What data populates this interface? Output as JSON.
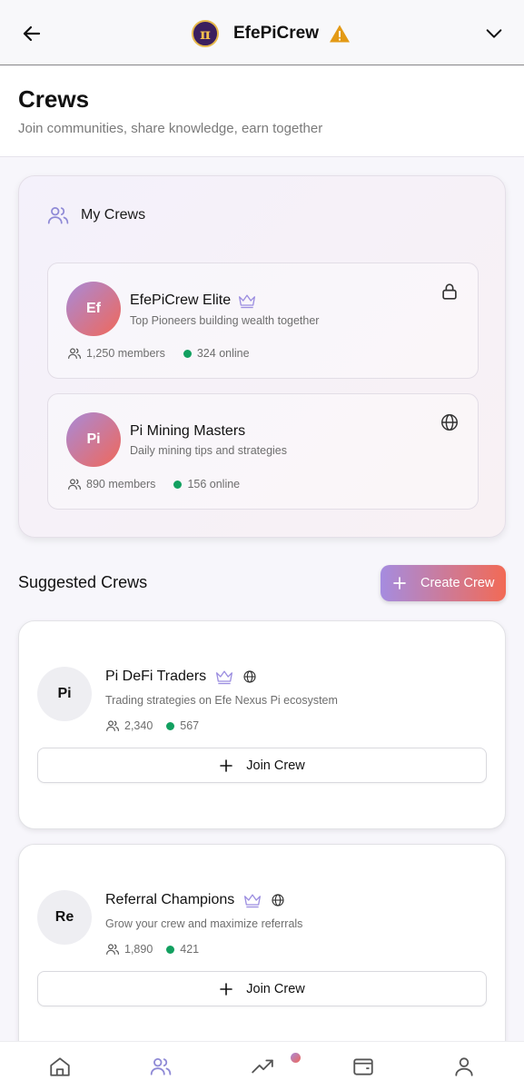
{
  "topbar": {
    "app_title": "EfePiCrew",
    "logo_glyph": "π",
    "back_icon": "arrow-left-icon",
    "warning_icon": "warning-icon",
    "chevron_icon": "chevron-down-icon"
  },
  "header": {
    "title": "Crews",
    "subtitle": "Join communities, share knowledge, earn together"
  },
  "my_crews": {
    "label": "My Crews",
    "items": [
      {
        "initials": "Ef",
        "name": "EfePiCrew Elite",
        "description": "Top Pioneers building wealth together",
        "members": "1,250 members",
        "online": "324 online",
        "badge_icon": "crown-icon",
        "corner_icon": "lock-icon"
      },
      {
        "initials": "Pi",
        "name": "Pi Mining Masters",
        "description": "Daily mining tips and strategies",
        "members": "890 members",
        "online": "156 online",
        "corner_icon": "globe-icon"
      }
    ]
  },
  "suggested": {
    "title": "Suggested Crews",
    "create_label": "Create Crew",
    "join_label": "Join Crew",
    "items": [
      {
        "initials": "Pi",
        "name": "Pi DeFi Traders",
        "description": "Trading strategies on Efe Nexus Pi ecosystem",
        "members": "2,340",
        "online": "567"
      },
      {
        "initials": "Re",
        "name": "Referral Champions",
        "description": "Grow your crew and maximize referrals",
        "members": "1,890",
        "online": "421"
      }
    ]
  },
  "bottom_nav": {
    "items": [
      "home-icon",
      "crews-icon",
      "trending-icon",
      "wallet-icon",
      "profile-icon"
    ],
    "active": "crews-icon"
  },
  "colors": {
    "accent_gradient_start": "#a88ad8",
    "accent_gradient_end": "#f0685a",
    "online_dot": "#12a060",
    "crown": "#9c8ee0",
    "warning": "#e39a16"
  }
}
